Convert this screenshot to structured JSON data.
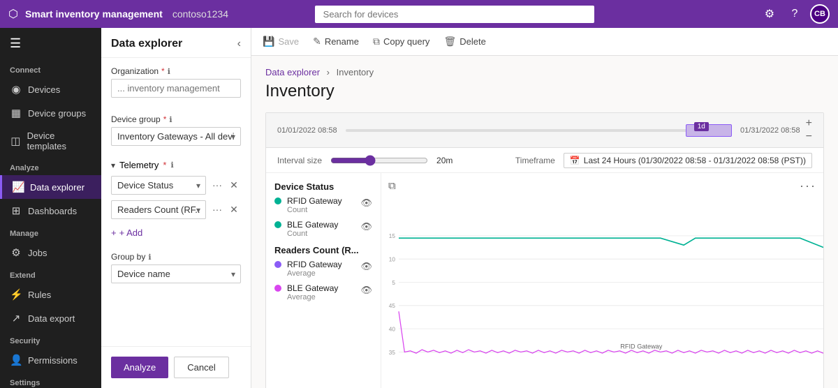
{
  "app": {
    "logo": "⬡",
    "name": "Smart inventory management",
    "tenant": "contoso1234",
    "search_placeholder": "Search for devices"
  },
  "topbar_icons": {
    "settings": "⚙",
    "help": "?",
    "avatar_initials": "CB"
  },
  "sidebar": {
    "hamburger": "☰",
    "sections": [
      {
        "label": "Connect",
        "items": [
          {
            "id": "devices",
            "icon": "◉",
            "label": "Devices"
          },
          {
            "id": "device-groups",
            "icon": "▦",
            "label": "Device groups"
          },
          {
            "id": "device-templates",
            "icon": "◫",
            "label": "Device templates"
          }
        ]
      },
      {
        "label": "Analyze",
        "items": [
          {
            "id": "data-explorer",
            "icon": "📈",
            "label": "Data explorer",
            "active": true
          },
          {
            "id": "dashboards",
            "icon": "⊞",
            "label": "Dashboards"
          }
        ]
      },
      {
        "label": "Manage",
        "items": [
          {
            "id": "jobs",
            "icon": "⚙",
            "label": "Jobs"
          }
        ]
      },
      {
        "label": "Extend",
        "items": [
          {
            "id": "rules",
            "icon": "⚡",
            "label": "Rules"
          },
          {
            "id": "data-export",
            "icon": "↗",
            "label": "Data export"
          }
        ]
      },
      {
        "label": "Security",
        "items": [
          {
            "id": "permissions",
            "icon": "👤",
            "label": "Permissions"
          }
        ]
      },
      {
        "label": "Settings",
        "items": []
      }
    ]
  },
  "panel": {
    "title": "Data explorer",
    "organization_label": "Organization",
    "organization_placeholder": "... inventory management",
    "device_group_label": "Device group",
    "device_group_value": "Inventory Gateways - All devices",
    "telemetry_label": "Telemetry",
    "telemetry_rows": [
      {
        "value": "Device Status"
      },
      {
        "value": "Readers Count (RF..."
      }
    ],
    "add_label": "+ Add",
    "group_by_label": "Group by",
    "group_by_info": "ℹ",
    "group_by_value": "Device name",
    "analyze_label": "Analyze",
    "cancel_label": "Cancel"
  },
  "toolbar": {
    "save_label": "Save",
    "rename_label": "Rename",
    "copy_query_label": "Copy query",
    "delete_label": "Delete",
    "save_icon": "💾",
    "rename_icon": "✎",
    "copy_icon": "⧉",
    "delete_icon": "🗑"
  },
  "breadcrumb": {
    "parent": "Data explorer",
    "current": "Inventory"
  },
  "page_title": "Inventory",
  "timeline": {
    "start": "01/01/2022 08:58",
    "end": "01/31/2022 08:58",
    "badge": "1d"
  },
  "interval": {
    "label": "Interval size",
    "value": "20m",
    "timeframe_label": "Timeframe",
    "timeframe_value": "Last 24 Hours (01/30/2022 08:58 - 01/31/2022 08:58 (PST))"
  },
  "legend": {
    "device_status_title": "Device Status",
    "device_status_items": [
      {
        "name": "RFID Gateway",
        "sub": "Count",
        "color": "#00b294"
      },
      {
        "name": "BLE Gateway",
        "sub": "Count",
        "color": "#00b294"
      }
    ],
    "readers_count_title": "Readers Count (R...",
    "readers_count_items": [
      {
        "name": "RFID Gateway",
        "sub": "Average",
        "color": "#8b5cf6"
      },
      {
        "name": "BLE Gateway",
        "sub": "Average",
        "color": "#d946ef"
      }
    ]
  },
  "chart": {
    "y_labels_right": [
      "15",
      "10",
      "5"
    ],
    "y_labels_left": [
      "45",
      "40",
      "35"
    ]
  },
  "rfid_gateway_label": "RFID Gateway"
}
